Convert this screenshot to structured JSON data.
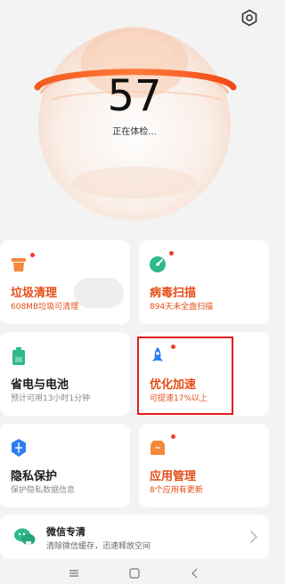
{
  "header": {
    "score": "57",
    "status": "正在体检..."
  },
  "cards": [
    {
      "id": "junk",
      "title": "垃圾清理",
      "subtitle": "608MB垃圾可清理",
      "alert": true,
      "icon": "trash-icon"
    },
    {
      "id": "virus",
      "title": "病毒扫描",
      "subtitle": "894天未全盘扫描",
      "alert": true,
      "icon": "shield-scan-icon"
    },
    {
      "id": "battery",
      "title": "省电与电池",
      "subtitle": "预计可用13小时1分钟",
      "alert": false,
      "icon": "battery-icon"
    },
    {
      "id": "boost",
      "title": "优化加速",
      "subtitle": "可提速17%以上",
      "alert": true,
      "icon": "rocket-icon"
    },
    {
      "id": "privacy",
      "title": "隐私保护",
      "subtitle": "保护隐私数据信息",
      "alert": false,
      "icon": "privacy-shield-icon"
    },
    {
      "id": "apps",
      "title": "应用管理",
      "subtitle": "8个应用有更新",
      "alert": true,
      "icon": "app-box-icon"
    }
  ],
  "wechat": {
    "title": "微信专清",
    "subtitle": "清除微信缓存，迅速释放空间"
  },
  "colors": {
    "accent": "#ef6a2b",
    "alert_text": "#e64d17",
    "dot": "#ef3b33",
    "icon_green": "#2fb98a",
    "icon_blue": "#2d7ef0",
    "icon_orange": "#f5883a"
  },
  "navbar": {
    "icons": [
      "menu-icon",
      "home-square-icon",
      "back-icon"
    ]
  }
}
